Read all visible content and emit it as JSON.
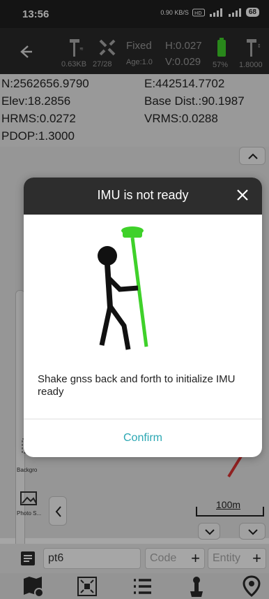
{
  "status_bar": {
    "time": "13:56",
    "speed": "0.90 KB/S",
    "battery": "68"
  },
  "toolbar": {
    "data_size": "0.63KB",
    "satellites": "27/28",
    "solution": "Fixed",
    "age": "Age:1.0",
    "h_precision": "H:0.027",
    "v_precision": "V:0.029",
    "battery": "57%",
    "version": "1.8000"
  },
  "info": {
    "northing": "N:2562656.9790",
    "easting": "E:442514.7702",
    "elevation": "Elev:18.2856",
    "base_dist": "Base Dist.:90.1987",
    "hrms": "HRMS:0.0272",
    "vrms": "VRMS:0.0288",
    "pdop": "PDOP:1.3000"
  },
  "map": {
    "scale": "100m",
    "side_labels": [
      "Backgro",
      "Photo S..."
    ]
  },
  "dialog": {
    "title": "IMU is not ready",
    "message": "Shake gnss back and forth to initialize IMU ready",
    "confirm_label": "Confirm"
  },
  "bottom": {
    "point_name": "pt6",
    "code_label": "Code",
    "entity_label": "Entity"
  },
  "colors": {
    "accent": "#2ba7b3",
    "pole_green": "#3fd12a",
    "dialog_header": "#2d2d2d"
  }
}
